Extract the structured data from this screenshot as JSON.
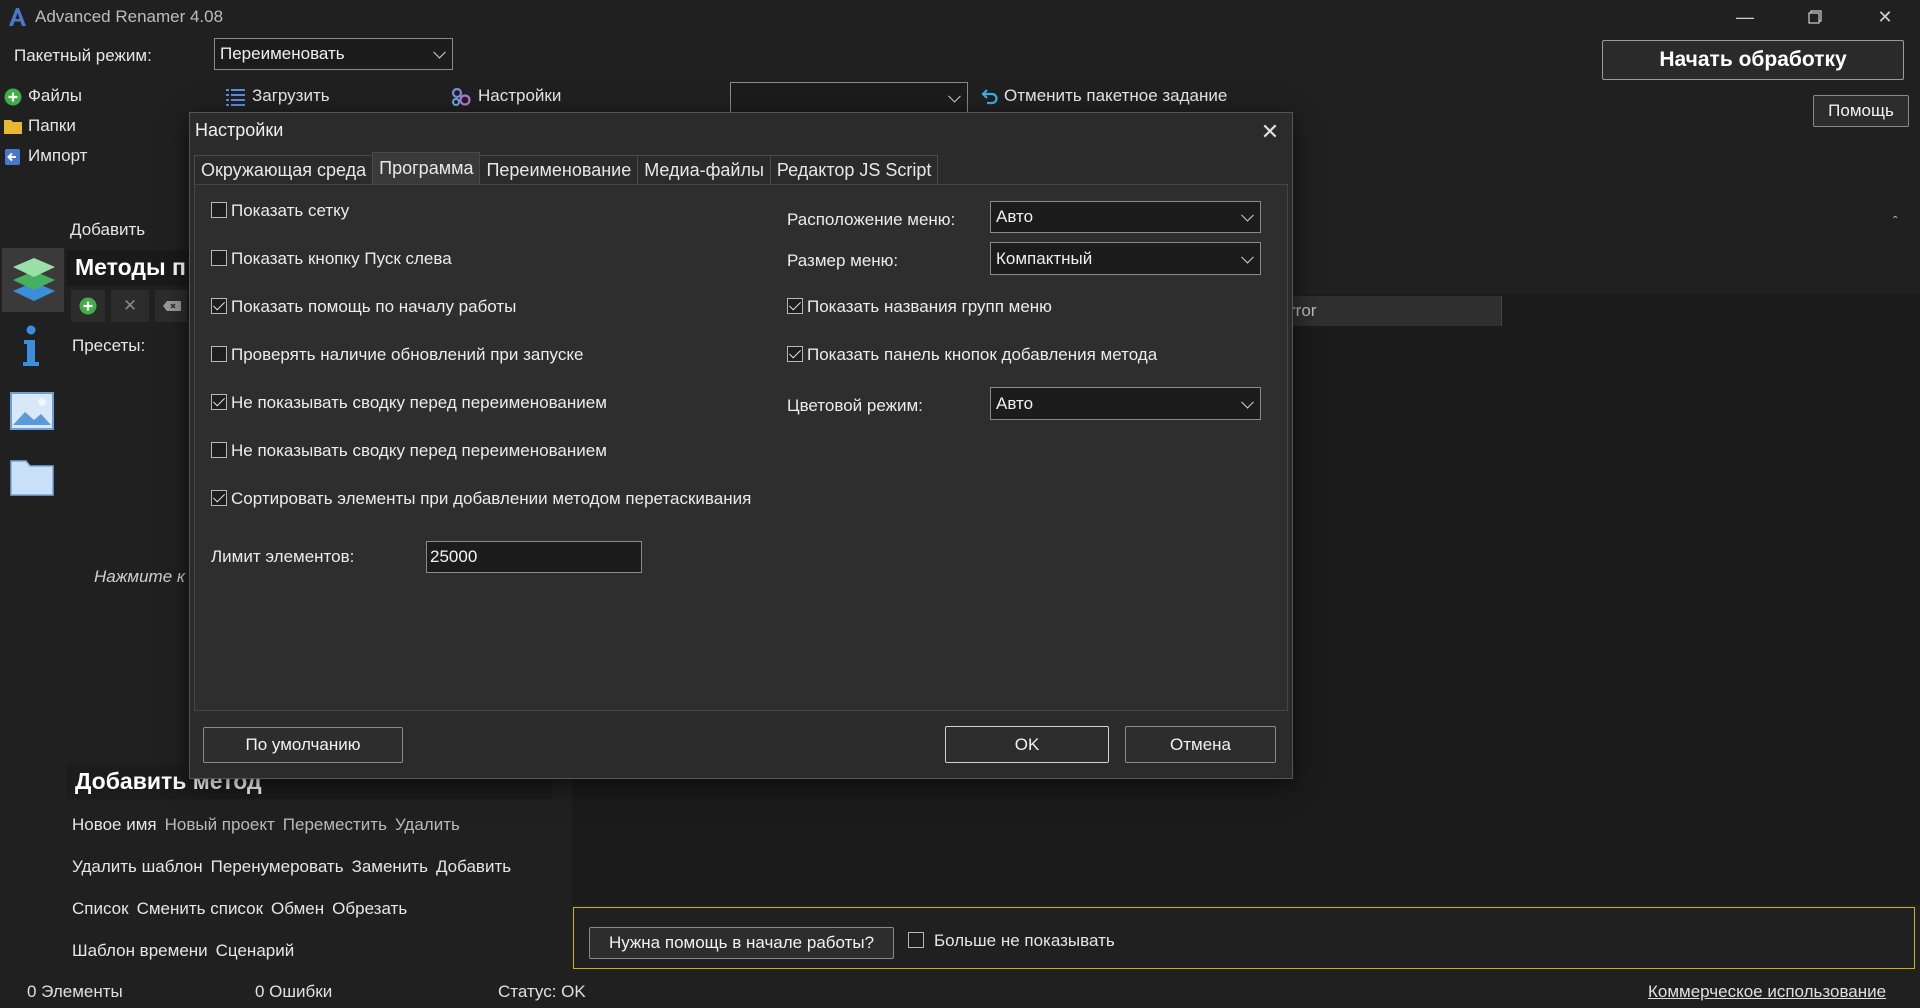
{
  "app": {
    "title": "Advanced Renamer 4.08",
    "batch_mode_label": "Пакетный режим:",
    "batch_mode_value": "Переименовать",
    "start_button": "Начать обработку",
    "help_button": "Помощь",
    "left_nav": [
      {
        "label": "Файлы",
        "icon": "add-files-icon"
      },
      {
        "label": "Папки",
        "icon": "folder-icon"
      },
      {
        "label": "Импорт",
        "icon": "import-icon"
      }
    ],
    "toolbar": {
      "load": "Загрузить",
      "settings": "Настройки",
      "batch_select_value": "",
      "cancel_batch": "Отменить пакетное задание"
    },
    "add_label": "Добавить",
    "methods_header": "Методы п",
    "presets_label": "Пресеты:",
    "hint_text": "Нажмите к",
    "column_header_fragment": "rror",
    "add_method_header": "Добавить метод",
    "method_rows": [
      [
        "Новое имя",
        "Новый проект",
        "Переместить",
        "Удалить"
      ],
      [
        "Удалить шаблон",
        "Перенумеровать",
        "Заменить",
        "Добавить"
      ],
      [
        "Список",
        "Сменить список",
        "Обмен",
        "Обрезать"
      ],
      [
        "Шаблон времени",
        "Сценарий"
      ]
    ],
    "help_strip": {
      "button": "Нужна помощь в начале работы?",
      "dont_show": "Больше не показывать",
      "dont_show_checked": false
    },
    "status_bar": {
      "items": "0 Элементы",
      "errors": "0 Ошибки",
      "status": "Статус: OK",
      "license_link": "Коммерческое использование"
    }
  },
  "dialog": {
    "title": "Настройки",
    "tabs": [
      "Окружающая среда",
      "Программа",
      "Переименование",
      "Медиа-файлы",
      "Редактор JS Script"
    ],
    "active_tab": "Программа",
    "left_options": [
      {
        "label": "Показать сетку",
        "checked": false
      },
      {
        "label": "Показать кнопку Пуск слева",
        "checked": false
      },
      {
        "label": "Показать помощь по началу работы",
        "checked": true
      },
      {
        "label": "Проверять наличие обновлений при запуске",
        "checked": false
      },
      {
        "label": "Не показывать сводку перед переименованием",
        "checked": true
      },
      {
        "label": "Не показывать сводку перед переименованием",
        "checked": false
      },
      {
        "label": "Сортировать элементы при добавлении методом перетаскивания",
        "checked": true
      }
    ],
    "limit_label": "Лимит элементов:",
    "limit_value": "25000",
    "menu_position_label": "Расположение меню:",
    "menu_position_value": "Авто",
    "menu_size_label": "Размер меню:",
    "menu_size_value": "Компактный",
    "show_group_names": {
      "label": "Показать названия групп меню",
      "checked": true
    },
    "show_add_buttons": {
      "label": "Показать панель кнопок добавления метода",
      "checked": true
    },
    "color_mode_label": "Цветовой режим:",
    "color_mode_value": "Авто",
    "default_button": "По умолчанию",
    "ok_button": "OK",
    "cancel_button": "Отмена"
  },
  "colors": {
    "background": "#202020",
    "dialog_bg": "#2b2b2b",
    "accent_green": "#3fae49",
    "folder_yellow": "#e8b830",
    "help_border": "#c8b400",
    "link_blue": "#5aa0e6"
  }
}
